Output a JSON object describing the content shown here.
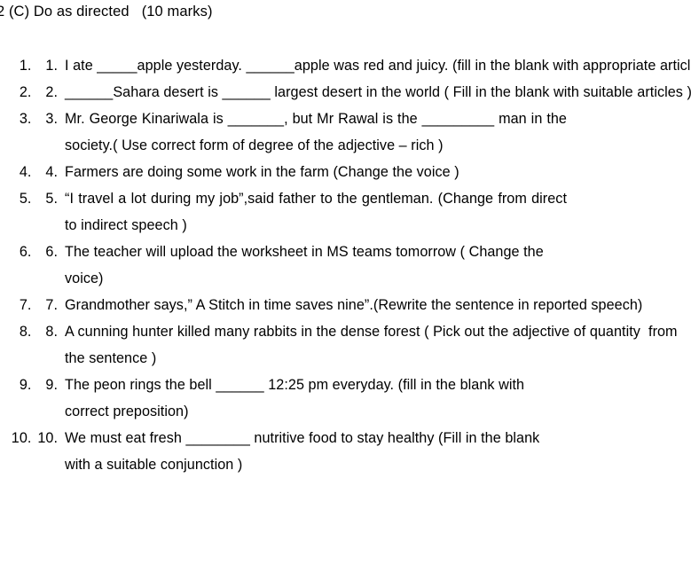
{
  "document": {
    "heading": "2 (C) Do as directed   (10 marks)",
    "marks": "(10 marks)",
    "section_label": "2 (C) Do as directed"
  },
  "questions": [
    {
      "number": "1.",
      "text": "I ate _____apple yesterday. ______apple was red and juicy. (fill in the blank with appropriate articles )",
      "align": "justify",
      "width_class": "w-full"
    },
    {
      "number": "2.",
      "text": "______Sahara desert is ______ largest desert in the world ( Fill in the blank with suitable articles )",
      "align": "justify",
      "width_class": "w-full"
    },
    {
      "number": "3.",
      "text": "Mr. George Kinariwala is _______, but Mr Rawal is the _________ man in the society.( Use correct form of degree of the adjective – rich )",
      "align": "justify",
      "width_class": "w-narrow"
    },
    {
      "number": "4.",
      "text": "Farmers are doing some work in the farm (Change the voice )",
      "align": "left",
      "width_class": "w-narrow"
    },
    {
      "number": "5.",
      "text": "“I travel a lot during my job”,said father to the gentleman. (Change from direct to indirect speech )",
      "align": "justify",
      "width_class": "w-narrow"
    },
    {
      "number": "6.",
      "text": "The teacher will upload the worksheet in MS teams tomorrow ( Change the voice)",
      "align": "left",
      "width_class": "w-short"
    },
    {
      "number": "7.",
      "text": "Grandmother says,” A Stitch in time saves nine”.(Rewrite the sentence in reported speech)",
      "align": "left",
      "width_class": "w-mid"
    },
    {
      "number": "8.",
      "text": "A cunning hunter killed many rabbits in the dense forest ( Pick out the adjective of quantity  from the sentence )",
      "align": "left",
      "width_class": "w-mid"
    },
    {
      "number": "9.",
      "text": "The peon rings the bell ______ 12:25 pm everyday. (fill in the blank with correct preposition)",
      "align": "left",
      "width_class": "w-short"
    },
    {
      "number": "10.",
      "text": "We must eat fresh ________ nutritive food to stay healthy (Fill in the blank with a suitable conjunction )",
      "align": "left",
      "width_class": "w-short"
    }
  ],
  "style": {
    "text_color": "#000000",
    "background_color": "#ffffff"
  }
}
